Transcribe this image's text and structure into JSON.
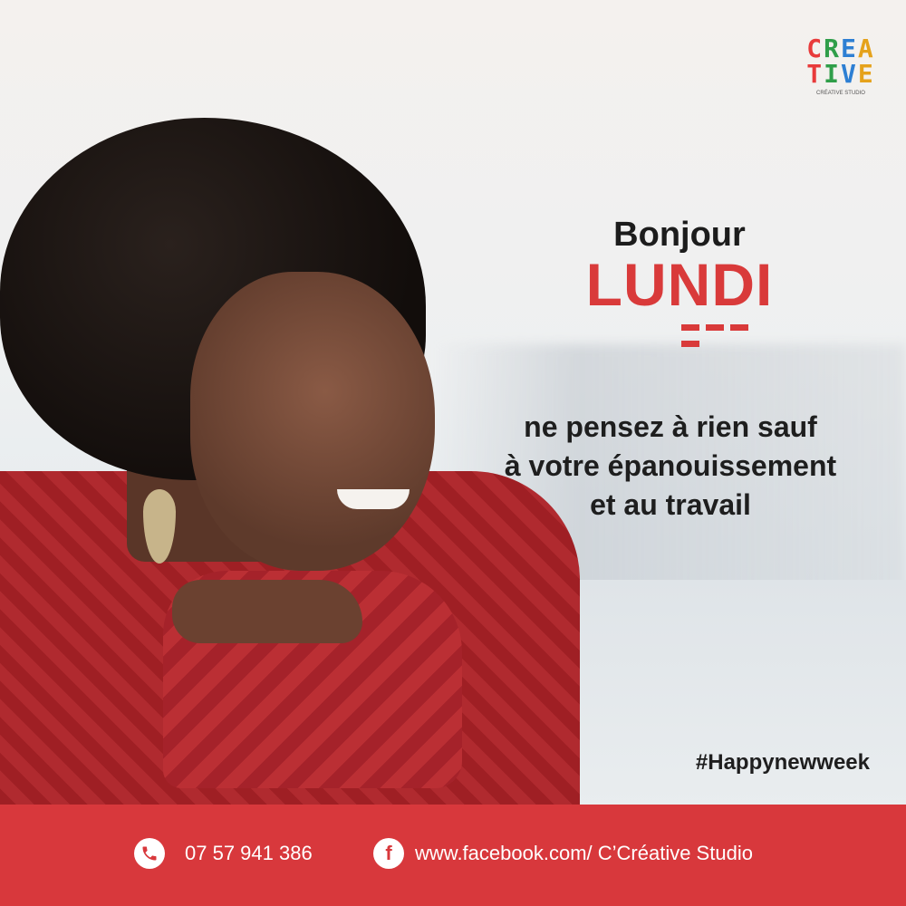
{
  "brand": {
    "logo_line1": [
      "C",
      "R",
      "E",
      "A"
    ],
    "logo_line2": [
      "T",
      "I",
      "V",
      "E"
    ],
    "logo_subtitle": "CRÉATIVE STUDIO",
    "colors": [
      "#e83b3b",
      "#2f9e49",
      "#2d7fd3",
      "#e5a21b"
    ]
  },
  "headline": {
    "greeting": "Bonjour",
    "day": "LUNDI"
  },
  "message": {
    "line1": "ne pensez à rien sauf",
    "line2": "à votre épanouissement",
    "line3": "et au travail"
  },
  "hashtag": "#Happynewweek",
  "footer": {
    "phone_icon": "phone-icon",
    "phone": "07 57 941 386",
    "facebook_icon": "facebook-icon",
    "facebook_icon_glyph": "f",
    "facebook_url": "www.facebook.com/ C’Créative Studio",
    "background": "#d8383c"
  },
  "accent": "#d93a3a"
}
